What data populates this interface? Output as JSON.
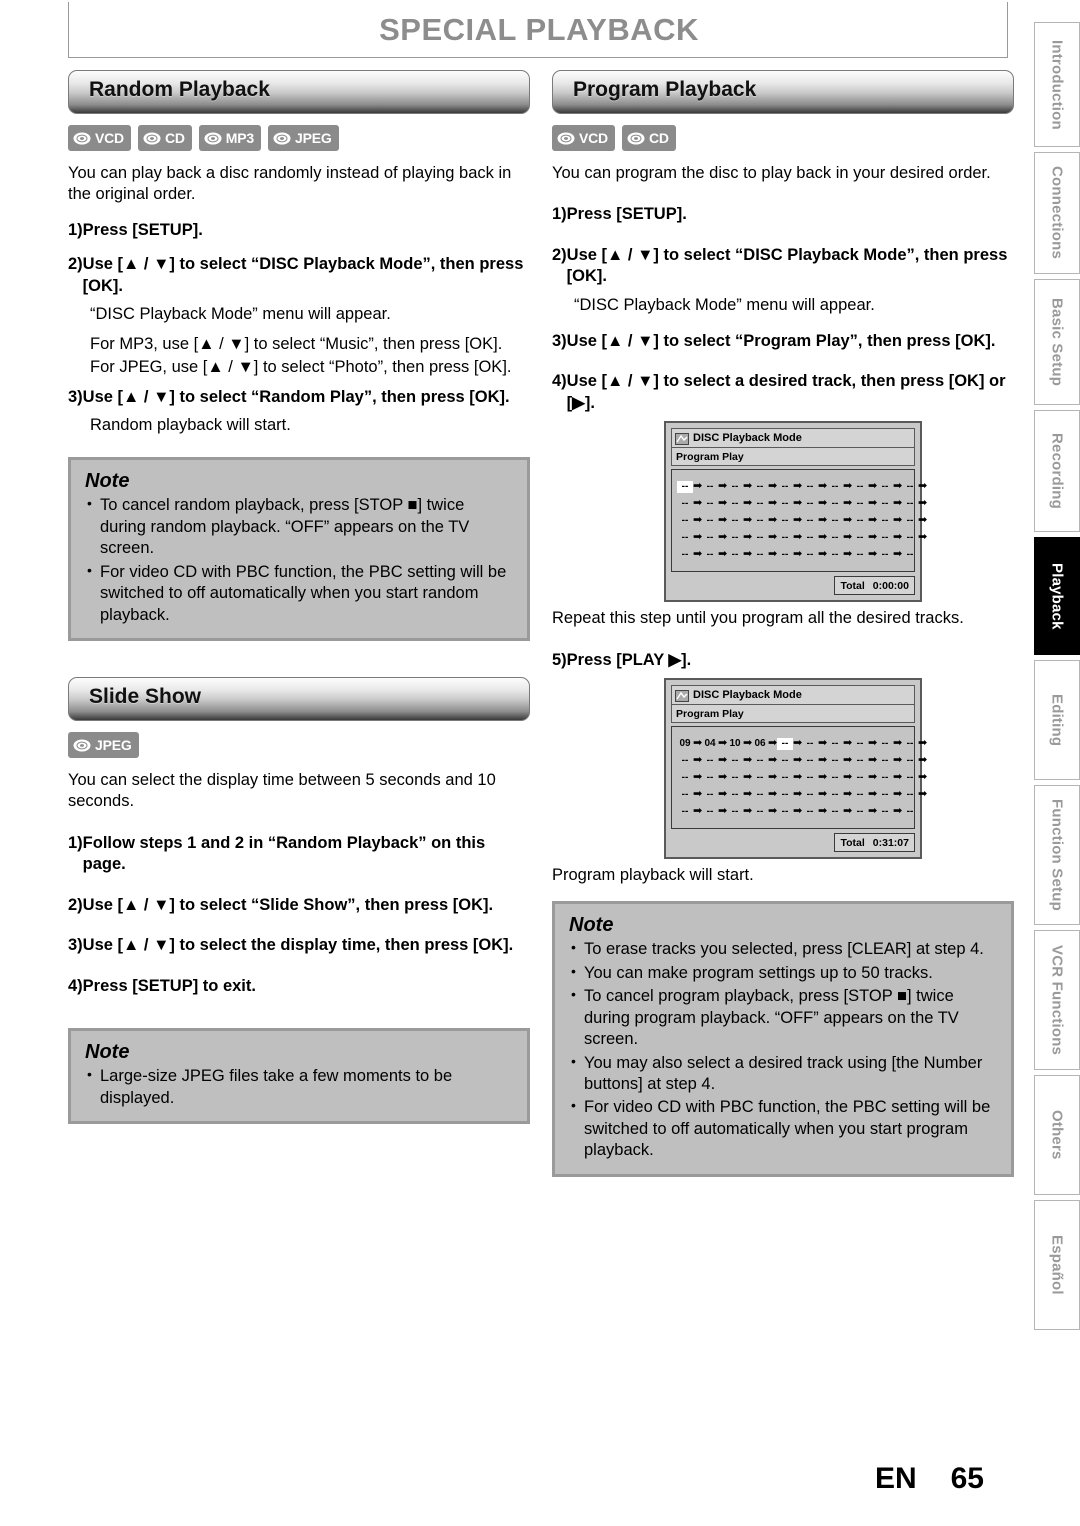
{
  "page": {
    "title": "SPECIAL PLAYBACK",
    "footer_lang": "EN",
    "footer_page": "65"
  },
  "sidebar": {
    "items": [
      {
        "label": "Introduction",
        "active": false
      },
      {
        "label": "Connections",
        "active": false
      },
      {
        "label": "Basic Setup",
        "active": false
      },
      {
        "label": "Recording",
        "active": false
      },
      {
        "label": "Playback",
        "active": true
      },
      {
        "label": "Editing",
        "active": false
      },
      {
        "label": "Function Setup",
        "active": false
      },
      {
        "label": "VCR Functions",
        "active": false
      },
      {
        "label": "Others",
        "active": false
      },
      {
        "label": "Español",
        "active": false
      }
    ]
  },
  "random": {
    "heading": "Random Playback",
    "badges": [
      "VCD",
      "CD",
      "MP3",
      "JPEG"
    ],
    "intro": "You can play back a disc randomly instead of playing back in the original order.",
    "steps": [
      {
        "num": "1)",
        "text": "Press [SETUP]."
      },
      {
        "num": "2)",
        "text": "Use [▲ / ▼] to select “DISC Playback Mode”, then press [OK]."
      },
      {
        "num": "3)",
        "text": "Use [▲ / ▼] to select “Random Play”, then press [OK]."
      }
    ],
    "sub_2a": "“DISC Playback Mode” menu will appear.",
    "sub_2b": "For MP3, use [▲ / ▼] to select “Music”, then press [OK].",
    "sub_2c": "For JPEG, use [▲ / ▼] to select “Photo”, then press [OK].",
    "sub_3": "Random playback will start.",
    "note": {
      "title": "Note",
      "items": [
        "To cancel random playback, press [STOP ■] twice during random playback. “OFF” appears on the TV screen.",
        "For video CD with PBC function, the PBC setting will be switched to off automatically when you start random playback."
      ]
    }
  },
  "slideshow": {
    "heading": "Slide Show",
    "badges": [
      "JPEG"
    ],
    "intro": "You can select the display time between 5 seconds and 10 seconds.",
    "steps": [
      {
        "num": "1)",
        "text": "Follow steps 1 and 2 in “Random Playback” on this page."
      },
      {
        "num": "2)",
        "text": "Use [▲ / ▼] to select “Slide Show”, then press [OK]."
      },
      {
        "num": "3)",
        "text": "Use [▲ / ▼] to select the display time, then press [OK]."
      },
      {
        "num": "4)",
        "text": "Press [SETUP] to exit."
      }
    ],
    "note": {
      "title": "Note",
      "items": [
        "Large-size JPEG files take a few moments to be displayed."
      ]
    }
  },
  "program": {
    "heading": "Program Playback",
    "badges": [
      "VCD",
      "CD"
    ],
    "intro": "You can program the disc to play back in your desired order.",
    "steps": [
      {
        "num": "1)",
        "text": "Press [SETUP]."
      },
      {
        "num": "2)",
        "text": "Use [▲ / ▼] to select “DISC Playback Mode”, then press [OK]."
      },
      {
        "num": "3)",
        "text": "Use [▲ / ▼] to select “Program Play”, then press [OK]."
      },
      {
        "num": "4)",
        "text": "Use [▲ / ▼] to select a desired track, then press [OK] or [▶]."
      },
      {
        "num": "5)",
        "text": "Press [PLAY ▶]."
      }
    ],
    "sub_2a": "“DISC Playback Mode” menu will appear.",
    "sub_4": "Repeat this step until you program all the desired tracks.",
    "sub_5": "Program playback will start.",
    "osd_empty": {
      "title": "DISC Playback Mode",
      "subtitle": "Program Play",
      "total_label": "Total",
      "total_value": "0:00:00",
      "selected_index": 0,
      "cells": [
        "--",
        "--",
        "--",
        "--",
        "--",
        "--",
        "--",
        "--",
        "--",
        "--",
        "--",
        "--",
        "--",
        "--",
        "--",
        "--",
        "--",
        "--",
        "--",
        "--",
        "--",
        "--",
        "--",
        "--",
        "--",
        "--",
        "--",
        "--",
        "--",
        "--",
        "--",
        "--",
        "--",
        "--",
        "--",
        "--",
        "--",
        "--",
        "--",
        "--",
        "--",
        "--",
        "--",
        "--",
        "--",
        "--",
        "--",
        "--",
        "--",
        "--"
      ]
    },
    "osd_filled": {
      "title": "DISC Playback Mode",
      "subtitle": "Program Play",
      "total_label": "Total",
      "total_value": "0:31:07",
      "selected_index": 4,
      "cells": [
        "09",
        "04",
        "10",
        "06",
        "--",
        "--",
        "--",
        "--",
        "--",
        "--",
        "--",
        "--",
        "--",
        "--",
        "--",
        "--",
        "--",
        "--",
        "--",
        "--",
        "--",
        "--",
        "--",
        "--",
        "--",
        "--",
        "--",
        "--",
        "--",
        "--",
        "--",
        "--",
        "--",
        "--",
        "--",
        "--",
        "--",
        "--",
        "--",
        "--",
        "--",
        "--",
        "--",
        "--",
        "--",
        "--",
        "--",
        "--",
        "--",
        "--"
      ]
    },
    "note": {
      "title": "Note",
      "items": [
        "To erase tracks you selected, press [CLEAR] at step 4.",
        "You can make program settings up to 50 tracks.",
        "To cancel program playback, press [STOP ■] twice during program playback. “OFF” appears on the TV screen.",
        "You may also select a desired track using [the Number buttons] at step 4.",
        "For video CD with PBC function, the PBC setting will be switched to off automatically when you start program playback."
      ]
    }
  },
  "icons": {
    "disc": "disc-icon",
    "osd_title": "disc-playback-mode-icon",
    "arrow": "right-arrow-icon"
  }
}
